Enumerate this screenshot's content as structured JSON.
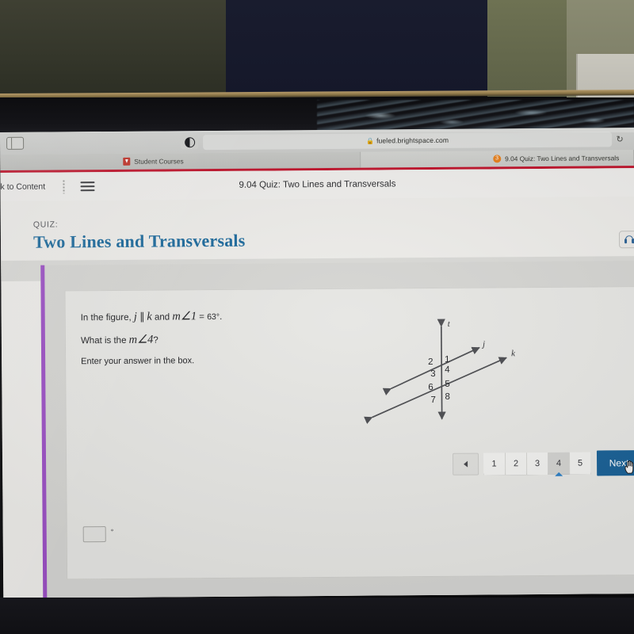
{
  "browser": {
    "url": "fueled.brightspace.com",
    "lock_icon": "lock-icon",
    "reload_icon": "reload-icon",
    "sidebar_toggle_icon": "sidebar-toggle-icon",
    "reader_icon": "contrast-toggle-icon",
    "tabs": [
      {
        "label": "Student Courses",
        "favicon": "brightspace-shield-icon",
        "active": false
      },
      {
        "label": "9.04 Quiz: Two Lines and Transversals",
        "favicon": "orange-badge-icon",
        "active": true
      }
    ]
  },
  "app_header": {
    "back_label": "k to Content",
    "menu_icon": "hamburger-menu-icon",
    "title": "9.04 Quiz: Two Lines and Transversals"
  },
  "quiz": {
    "eyebrow": "QUIZ:",
    "title": "Two Lines and Transversals",
    "tts_icon": "headphones-icon",
    "accent_color": "#9b4fc4",
    "title_color": "#1d6a9c"
  },
  "question": {
    "line1_prefix": "In the figure,",
    "line1_var_j": "j",
    "line1_parallel": "∥",
    "line1_var_k": "k",
    "line1_and": "and",
    "line1_measure": "m∠1",
    "line1_equals": "=",
    "line1_value": "63°",
    "line1_period": ".",
    "line2_prefix": "What is the",
    "line2_measure": "m∠4",
    "line2_suffix": "?",
    "line3": "Enter your answer in the box.",
    "answer_value": "",
    "answer_placeholder": "",
    "degree_symbol": "°"
  },
  "figure": {
    "transversal_label": "t",
    "line_j_label": "j",
    "line_k_label": "k",
    "angles_top": [
      "2",
      "1",
      "3",
      "4"
    ],
    "angles_bottom": [
      "6",
      "5",
      "7",
      "8"
    ]
  },
  "pagination": {
    "prev_icon": "triangle-left-icon",
    "pages": [
      "1",
      "2",
      "3",
      "4",
      "5"
    ],
    "current_page": "4",
    "next_label": "Next",
    "next_icon": "triangle-right-icon",
    "next_color": "#1a6196",
    "cursor_icon": "pointing-hand-cursor-icon"
  }
}
